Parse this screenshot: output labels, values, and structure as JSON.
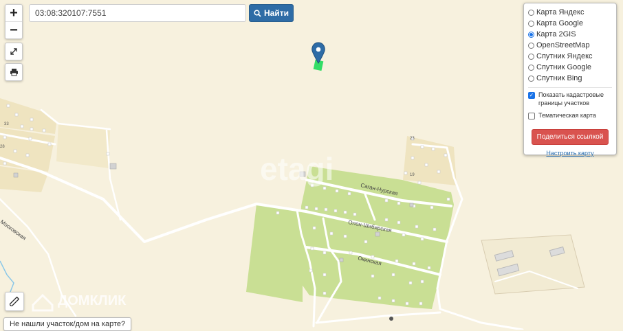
{
  "search": {
    "value": "03:08:320107:7551",
    "button_label": "Найти",
    "icon": "search-icon"
  },
  "controls": {
    "zoom_in": "+",
    "zoom_out": "−",
    "fullscreen_icon": "expand-icon",
    "print_icon": "print-icon",
    "ruler_icon": "ruler-icon"
  },
  "layers": [
    {
      "label": "Карта Яндекс",
      "selected": false
    },
    {
      "label": "Карта Google",
      "selected": false
    },
    {
      "label": "Карта 2GIS",
      "selected": true
    },
    {
      "label": "OpenStreetMap",
      "selected": false
    },
    {
      "label": "Спутник Яндекс",
      "selected": false
    },
    {
      "label": "Спутник Google",
      "selected": false
    },
    {
      "label": "Спутник Bing",
      "selected": false
    }
  ],
  "options": {
    "cadastral_label": "Показать кадастровые границы участков",
    "cadastral_checked": true,
    "thematic_label": "Тематическая карта",
    "thematic_checked": false
  },
  "share_button": "Поделиться ссылкой",
  "setup_link": "Настроить карту",
  "not_found_button": "Не нашли участок/дом на карте?",
  "watermarks": {
    "etagi": "etagi",
    "domclick": "ДОМКЛИК"
  },
  "streets": {
    "sagan": "Саган-Нурская",
    "olon": "Олон-Шибирская",
    "okinskaya": "Окинская",
    "moskovskaya": "Московская"
  },
  "house_numbers": {
    "n33": "33",
    "n28": "28",
    "n23": "23",
    "n19": "19"
  },
  "colors": {
    "background": "#f6f0dc",
    "greenzone": "#c9df94",
    "marker": "#2e6ca6",
    "plot": "#33dd66"
  }
}
